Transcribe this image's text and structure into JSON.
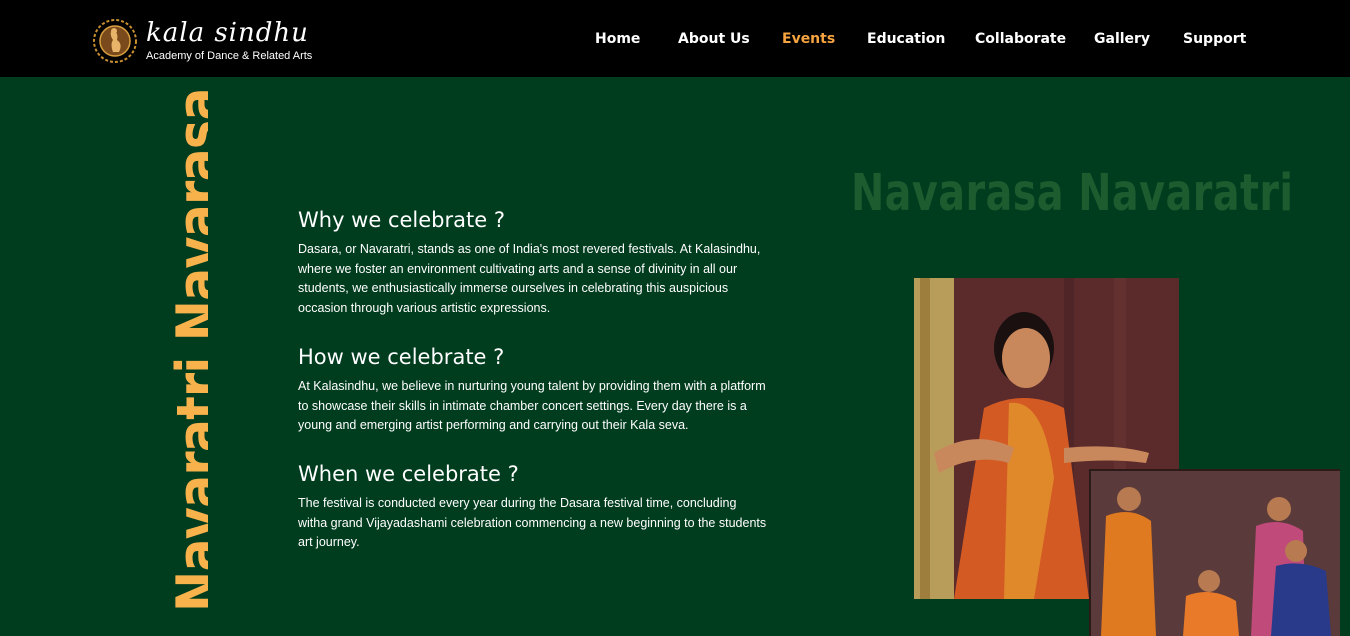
{
  "brand": {
    "name": "kala sindhu",
    "tagline": "Academy of Dance & Related Arts"
  },
  "nav": {
    "items": [
      {
        "label": "Home",
        "active": false
      },
      {
        "label": "About Us",
        "active": false
      },
      {
        "label": "Events",
        "active": true
      },
      {
        "label": "Education",
        "active": false
      },
      {
        "label": "Collaborate",
        "active": false
      },
      {
        "label": "Gallery",
        "active": false
      },
      {
        "label": "Support",
        "active": false
      }
    ]
  },
  "marquee": {
    "text": "Navaratri Navarasa Navaratri Navaras"
  },
  "event": {
    "title": "Navarasa Navaratri",
    "sections": [
      {
        "heading": "Why we celebrate ?",
        "body": "Dasara, or Navaratri, stands as one of India's most revered festivals. At Kalasindhu, where we foster an environment cultivating arts and a sense of divinity in all our students, we enthusiastically immerse ourselves in celebrating this auspicious occasion through various artistic expressions."
      },
      {
        "heading": "How we celebrate ?",
        "body": "At Kalasindhu, we believe in nurturing young talent by providing them with a platform to showcase their skills in intimate chamber concert settings. Every day there is a young and emerging artist performing and carrying out their Kala seva."
      },
      {
        "heading": "When we celebrate ?",
        "body": "The festival is conducted every year during the Dasara festival time, concluding witha grand Vijayadashami celebration commencing a new beginning to the students art journey."
      }
    ]
  },
  "colors": {
    "page_bg": "#003c1e",
    "header_bg": "#000000",
    "accent": "#f7a340",
    "marquee": "#f7b24c",
    "faded_title": "#1d5c2f"
  },
  "icons": {
    "logo": "dancer-emblem-icon"
  }
}
